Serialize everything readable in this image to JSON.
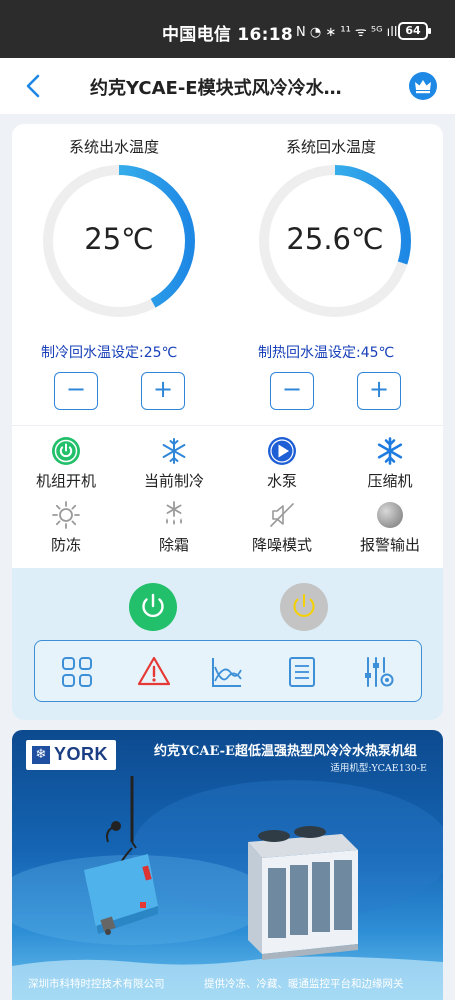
{
  "statusbar": {
    "carrier_time": "中国电信 16:18",
    "icons_text": "N ◔ ∗ ¹¹ ᯤ ⁵ᴳ ıll",
    "battery": "64"
  },
  "nav": {
    "title": "约克YCAE-E模块式风冷冷水…"
  },
  "gauges": [
    {
      "title": "系统出水温度",
      "value": "25℃",
      "fill_fraction": 0.42,
      "setpoint_label": "制冷回水温设定:25℃",
      "minus": "−",
      "plus": "+"
    },
    {
      "title": "系统回水温度",
      "value": "25.6℃",
      "fill_fraction": 0.3,
      "setpoint_label": "制热回水温设定:45℃",
      "minus": "−",
      "plus": "+"
    }
  ],
  "status_items": [
    {
      "label": "机组开机",
      "icon": "power-on-green-icon"
    },
    {
      "label": "当前制冷",
      "icon": "snowflake-icon"
    },
    {
      "label": "水泵",
      "icon": "pump-play-icon"
    },
    {
      "label": "压缩机",
      "icon": "compressor-snowflake-icon"
    },
    {
      "label": "防冻",
      "icon": "sun-frost-icon"
    },
    {
      "label": "除霜",
      "icon": "defrost-icon"
    },
    {
      "label": "降噪模式",
      "icon": "mute-speaker-icon"
    },
    {
      "label": "报警输出",
      "icon": "alarm-indicator-icon"
    }
  ],
  "colors": {
    "accent_blue": "#2f86d9",
    "ring_gradient_start": "#1e88e5",
    "ring_gradient_end": "#4fd3f0",
    "ring_track": "#eeeeee",
    "setpoint_text": "#1840b8",
    "power_on": "#22c06a",
    "power_off": "#c4c4c4",
    "control_bg": "#deeef8",
    "alarm_red": "#e53935"
  },
  "toolbar_icons": [
    "grid-icon",
    "warning-icon",
    "chart-icon",
    "list-icon",
    "settings-sliders-icon"
  ],
  "banner": {
    "brand": "YORK",
    "title": "约克YCAE-E超低温强热型风冷冷水热泵机组",
    "model": "适用机型:YCAE130-E",
    "company": "深圳市科特时控技术有限公司",
    "service": "提供冷冻、冷藏、暖通监控平台和边缘网关"
  }
}
